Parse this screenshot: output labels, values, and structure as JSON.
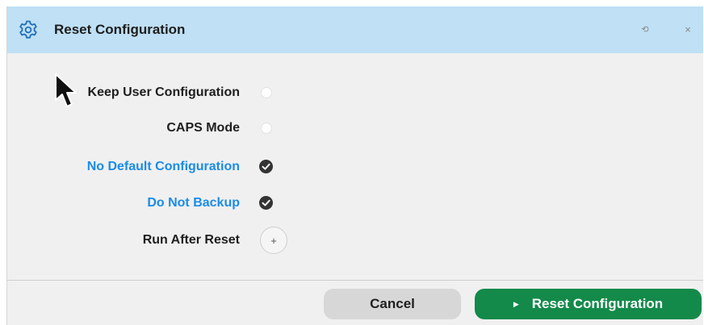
{
  "dialog": {
    "title": "Reset Configuration",
    "title_icon": "gear-icon",
    "restore_glyph": "⟲",
    "close_glyph": "×"
  },
  "options": [
    {
      "label": "Keep User Configuration",
      "state": "unchecked",
      "label_color": "#1e1e1e"
    },
    {
      "label": "CAPS Mode",
      "state": "unchecked",
      "label_color": "#1e1e1e"
    },
    {
      "label": "No Default Configuration",
      "state": "checked",
      "label_color": "#1a8ce8"
    },
    {
      "label": "Do Not Backup",
      "state": "checked",
      "label_color": "#1a8ce8"
    },
    {
      "label": "Run After Reset",
      "state": "add",
      "label_color": "#1e1e1e",
      "add_glyph": "+"
    }
  ],
  "footer": {
    "cancel_label": "Cancel",
    "reset_label": "Reset Configuration",
    "reset_icon": "play-icon",
    "reset_color": "#138a4a"
  },
  "colors": {
    "titlebar": "#bfe0f5",
    "accent_blue": "#1a8ce8"
  }
}
